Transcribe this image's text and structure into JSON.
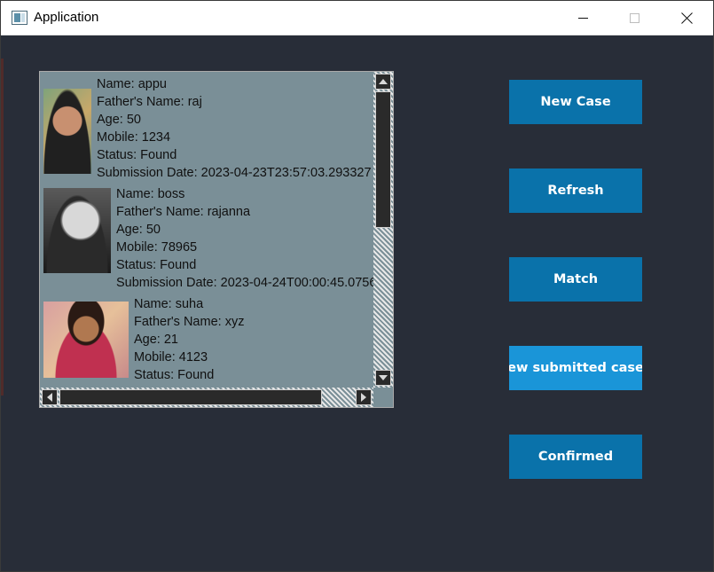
{
  "window": {
    "title": "Application",
    "icon": "app-window-icon"
  },
  "cases": [
    {
      "photo": "person-photo",
      "name": "Name: appu",
      "father": "Father's Name: raj",
      "age": "Age: 50",
      "mobile": "Mobile: 1234",
      "status": "Status: Found",
      "submission": "Submission Date: 2023-04-23T23:57:03.293327"
    },
    {
      "photo": "person-photo",
      "name": "Name: boss",
      "father": "Father's Name: rajanna",
      "age": "Age: 50",
      "mobile": "Mobile: 78965",
      "status": "Status: Found",
      "submission": "Submission Date: 2023-04-24T00:00:45.0756"
    },
    {
      "photo": "person-photo",
      "name": "Name: suha",
      "father": "Father's Name: xyz",
      "age": "Age: 21",
      "mobile": "Mobile: 4123",
      "status": "Status: Found"
    }
  ],
  "buttons": {
    "new_case": "New Case",
    "refresh": "Refresh",
    "match": "Match",
    "view_submitted": "ew submitted case",
    "confirmed": "Confirmed"
  },
  "colors": {
    "background": "#282d38",
    "list_background": "#7a8f97",
    "button": "#0a72aa",
    "button_active": "#1a95d8"
  }
}
